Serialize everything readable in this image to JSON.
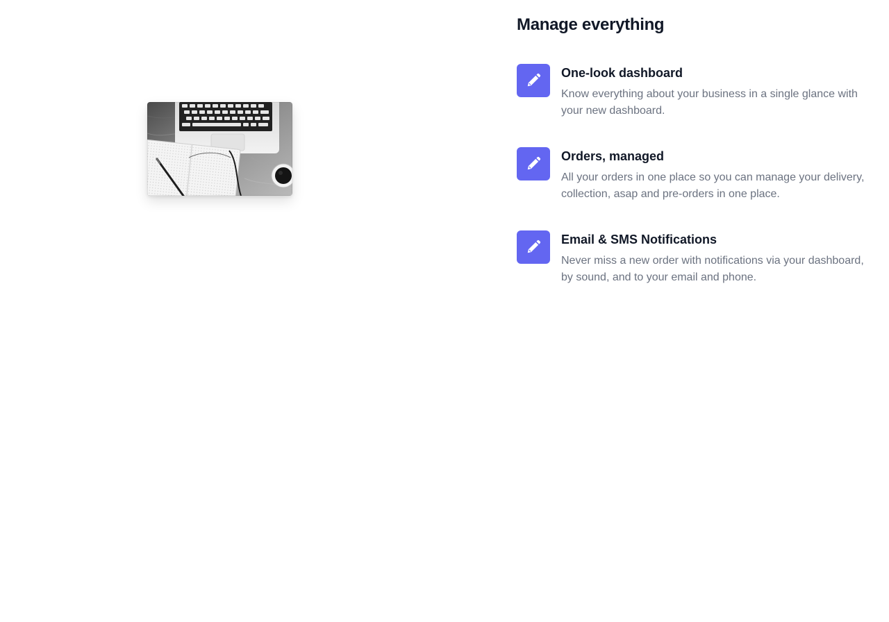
{
  "hero": {
    "image_icon": "laptop-notebook-coffee-photo"
  },
  "section": {
    "title": "Manage everything"
  },
  "features": [
    {
      "icon": "pencil-icon",
      "title": "One-look dashboard",
      "description": "Know everything about your business in a single glance with your new dashboard."
    },
    {
      "icon": "pencil-icon",
      "title": "Orders, managed",
      "description": "All your orders in one place so you can manage your delivery, collection, asap and pre-orders in one place."
    },
    {
      "icon": "pencil-icon",
      "title": "Email & SMS Notifications",
      "description": "Never miss a new order with notifications via your dashboard, by sound, and to your email and phone."
    }
  ],
  "colors": {
    "accent": "#6366f1",
    "heading": "#111827",
    "body_text": "#6b7280"
  }
}
